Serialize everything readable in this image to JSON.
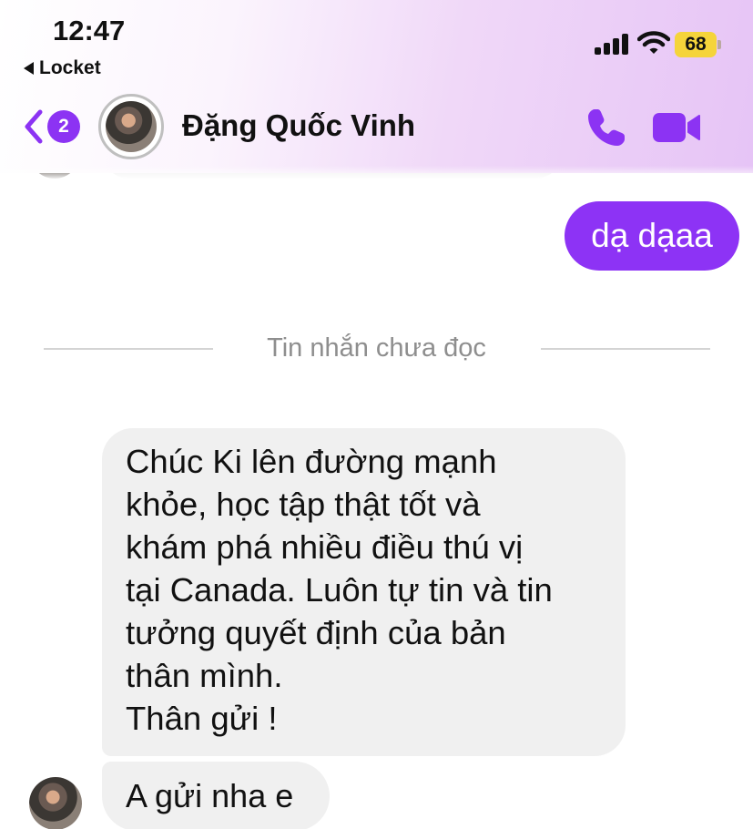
{
  "status_bar": {
    "time": "12:47",
    "back_app": "Locket",
    "battery_level": "68",
    "battery_color": "#f5d43a"
  },
  "header": {
    "unread_count": "2",
    "contact_name": "Đặng Quốc Vinh",
    "icons": [
      "chevron-left-icon",
      "phone-icon",
      "video-camera-icon"
    ],
    "accent_color": "#8c33f3"
  },
  "messages": {
    "outgoing_1": "dạ dạaa",
    "divider": "Tin nhắn chưa đọc",
    "incoming_1_lines": [
      "Chúc Ki lên đường mạnh",
      "khỏe, học tập thật tốt và",
      "khám phá nhiều điều thú vị",
      "tại Canada. Luôn tự tin và tin",
      "tưởng quyết định của bản",
      "thân mình.",
      "Thân gửi !"
    ],
    "incoming_2": "A gửi nha e"
  }
}
